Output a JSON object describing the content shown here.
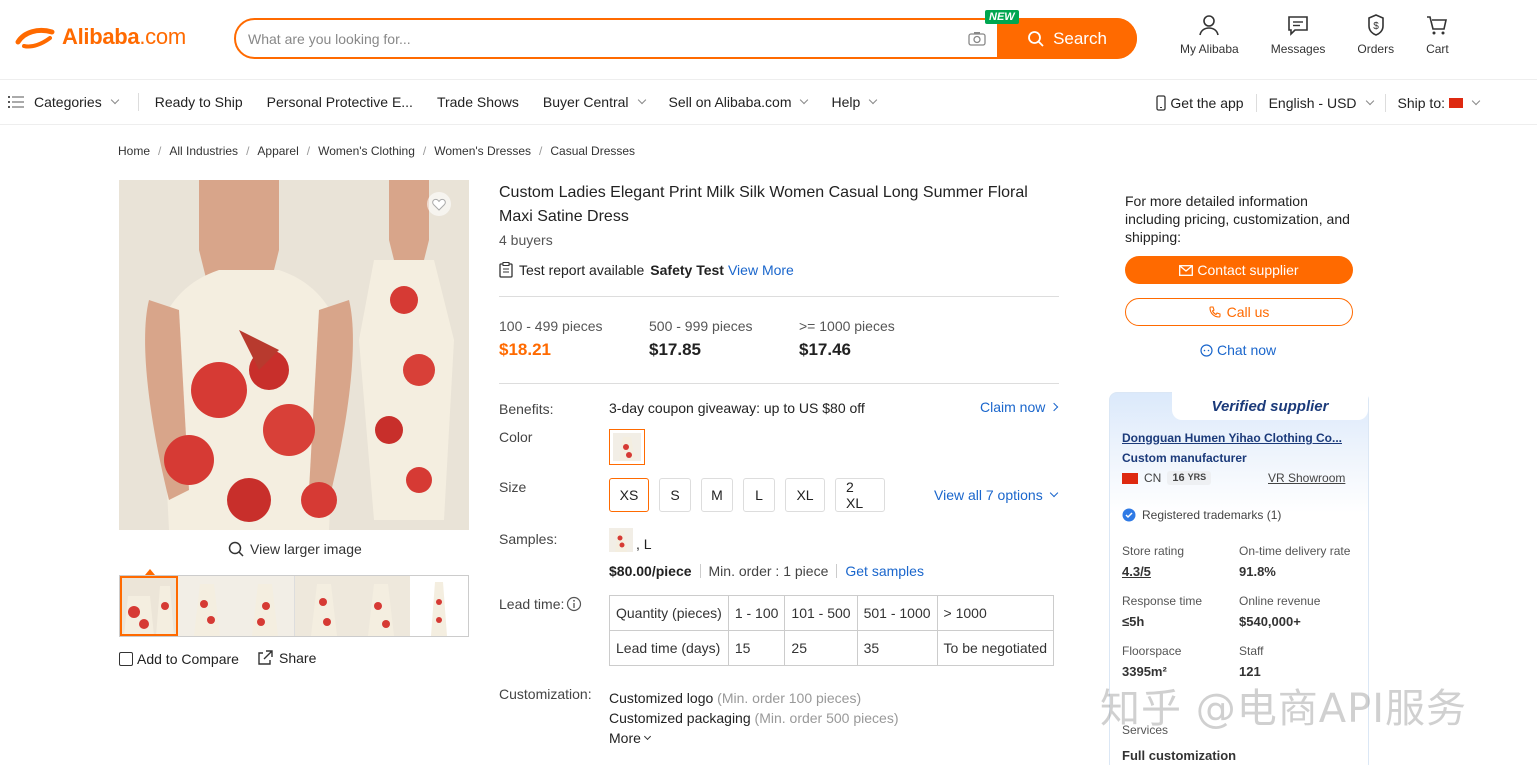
{
  "brand": {
    "logo_text_main": "Alibaba",
    "logo_text_suffix": ".com",
    "color": "#ff6a00"
  },
  "search": {
    "placeholder": "What are you looking for...",
    "new_badge": "NEW",
    "button_label": "Search"
  },
  "header_actions": [
    {
      "label": "My Alibaba",
      "icon": "user-icon"
    },
    {
      "label": "Messages",
      "icon": "message-icon"
    },
    {
      "label": "Orders",
      "icon": "orders-icon"
    },
    {
      "label": "Cart",
      "icon": "cart-icon"
    }
  ],
  "nav": {
    "categories": "Categories",
    "items": [
      "Ready to Ship",
      "Personal Protective E...",
      "Trade Shows",
      "Buyer Central",
      "Sell on Alibaba.com",
      "Help"
    ],
    "get_app": "Get the app",
    "language": "English - USD",
    "ship_to": "Ship to:"
  },
  "breadcrumb": [
    "Home",
    "All Industries",
    "Apparel",
    "Women's Clothing",
    "Women's Dresses",
    "Casual Dresses"
  ],
  "gallery": {
    "view_larger": "View larger image",
    "compare": "Add to Compare",
    "share": "Share",
    "thumb_count": 6
  },
  "product": {
    "title": "Custom Ladies Elegant Print Milk Silk Women Casual Long Summer Floral Maxi Satine Dress",
    "buyers": "4 buyers",
    "test_report": "Test report available",
    "test_name": "Safety Test",
    "view_more": "View More",
    "price_tiers": [
      {
        "qty": "100 - 499 pieces",
        "price": "$18.21"
      },
      {
        "qty": "500 - 999 pieces",
        "price": "$17.85"
      },
      {
        "qty": ">= 1000 pieces",
        "price": "$17.46"
      }
    ],
    "benefits_label": "Benefits:",
    "benefits_text": "3-day coupon giveaway: up to US $80 off",
    "claim_now": "Claim now",
    "color_label": "Color",
    "size_label": "Size",
    "sizes": [
      "XS",
      "S",
      "M",
      "L",
      "XL",
      "2 XL"
    ],
    "selected_size": "XS",
    "view_all": "View all 7 options",
    "samples_label": "Samples:",
    "sample_variant": ", L",
    "sample_price": "$80.00/piece",
    "sample_min": "Min. order : 1 piece",
    "get_samples": "Get samples",
    "lead_label": "Lead time:",
    "lead_table": {
      "row1": [
        "Quantity (pieces)",
        "1 - 100",
        "101 - 500",
        "501 - 1000",
        "> 1000"
      ],
      "row2": [
        "Lead time (days)",
        "15",
        "25",
        "35",
        "To be negotiated"
      ]
    },
    "custom_label": "Customization:",
    "customizations": [
      {
        "name": "Customized logo",
        "note": "(Min. order 100 pieces)"
      },
      {
        "name": "Customized packaging",
        "note": "(Min. order 500 pieces)"
      }
    ],
    "more": "More"
  },
  "side": {
    "info": "For more detailed information including pricing, customization, and shipping:",
    "contact": "Contact supplier",
    "call": "Call us",
    "chat": "Chat now"
  },
  "supplier": {
    "verified": "Verified supplier",
    "name": "Dongguan Humen Yihao Clothing Co...",
    "type": "Custom manufacturer",
    "country": "CN",
    "years": "16",
    "years_unit": "YRS",
    "vr": "VR Showroom",
    "trademarks": "Registered trademarks (1)",
    "stats": [
      {
        "label": "Store rating",
        "value": "4.3/5"
      },
      {
        "label": "On-time delivery rate",
        "value": "91.8%"
      },
      {
        "label": "Response time",
        "value": "≤5h"
      },
      {
        "label": "Online revenue",
        "value": "$540,000+"
      },
      {
        "label": "Floorspace",
        "value": "3395m²"
      },
      {
        "label": "Staff",
        "value": "121"
      }
    ],
    "services_label": "Services",
    "services_value": "Full customization"
  },
  "watermark": "知乎 @电商API服务"
}
